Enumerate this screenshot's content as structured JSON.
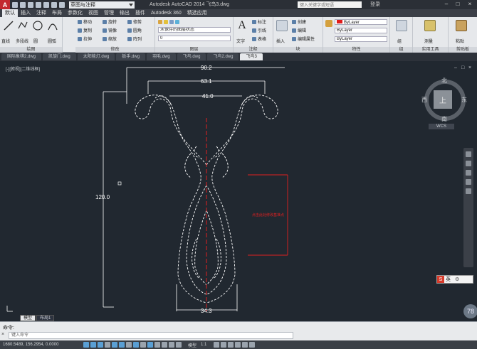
{
  "titlebar": {
    "logo": "A",
    "workspace": "草图与注释",
    "title": "Autodesk AutoCAD 2014   飞鸟3.dwg",
    "search_placeholder": "键入关键字或短语",
    "login": "登录"
  },
  "ribbon_tabs": [
    "默认",
    "插入",
    "注释",
    "布局",
    "参数化",
    "视图",
    "管理",
    "输出",
    "插件",
    "Autodesk 360",
    "精选应用"
  ],
  "ribbon": {
    "draw": {
      "label": "绘图",
      "tools": [
        "直线",
        "多段线",
        "圆",
        "圆弧"
      ]
    },
    "modify": {
      "label": "修改",
      "tools": [
        "移动",
        "旋转",
        "修剪",
        "复制",
        "镜像",
        "圆角",
        "拉伸",
        "缩放",
        "阵列"
      ]
    },
    "layers": {
      "label": "图层",
      "layer_state": "未保存的图层状态",
      "current_layer": "0"
    },
    "annotation": {
      "label": "注释",
      "tools": [
        "文字",
        "标注",
        "引线",
        "表格"
      ]
    },
    "block": {
      "label": "块",
      "tools": [
        "插入",
        "创建",
        "编辑",
        "编辑属性"
      ]
    },
    "properties": {
      "label": "特性",
      "color": "ByLayer",
      "linetype": "ByLayer",
      "lineweight": "ByLayer"
    },
    "groups": {
      "label": "组",
      "tools": [
        "组"
      ]
    },
    "utilities": {
      "label": "实用工具",
      "tools": [
        "测量"
      ]
    },
    "clipboard": {
      "label": "剪贴板",
      "tools": [
        "粘贴"
      ]
    }
  },
  "doc_tabs": [
    {
      "label": "国际象棋2.dwg",
      "active": false
    },
    {
      "label": "凯旋门.dwg",
      "active": false
    },
    {
      "label": "太阳能灯.dwg",
      "active": false
    },
    {
      "label": "扳手.dwg",
      "active": false
    },
    {
      "label": "羽毛.dwg",
      "active": false
    },
    {
      "label": "飞鸟.dwg",
      "active": false
    },
    {
      "label": "飞鸟2.dwg",
      "active": false
    },
    {
      "label": "飞鸟3",
      "active": true
    }
  ],
  "canvas": {
    "viewport_label": "[-][俯视][二维线框]",
    "dimensions": {
      "top_outer": "90.2",
      "top_mid": "63.1",
      "top_inner": "41.0",
      "height": "120.0",
      "bottom": "34.3"
    },
    "annotation_note": "点击此处修改基准点",
    "colors": {
      "background": "#212830",
      "lines": "#ffffff",
      "centerline": "#e02020"
    }
  },
  "viewcube": {
    "face": "上",
    "north": "北",
    "south": "南",
    "east": "东",
    "west": "西",
    "wcs": "WCS"
  },
  "layout_tabs": [
    {
      "label": "模型",
      "active": true
    },
    {
      "label": "布局1",
      "active": false
    }
  ],
  "ime": {
    "label": "英"
  },
  "badge": {
    "value": "78"
  },
  "command": {
    "history": "命令:",
    "placeholder": "键入命令"
  },
  "status": {
    "coords": "1680.5489, 156.2954, 0.0000",
    "model": "模型",
    "scale": "1:1"
  }
}
